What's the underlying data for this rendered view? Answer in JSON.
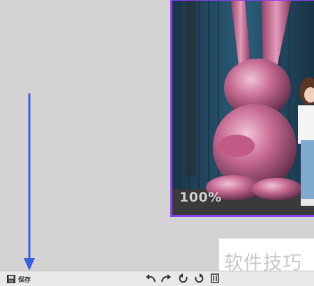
{
  "photo": {
    "zoom_label": "100%",
    "frame_color": "#8a3ff0"
  },
  "annotation": {
    "arrow_color": "#3a5ee0",
    "points_to": "save-button"
  },
  "toolbar": {
    "save_label": "保存",
    "icons": [
      "save-icon",
      "undo-icon",
      "redo-icon",
      "rotate-left-icon",
      "rotate-right-icon",
      "crop-icon"
    ]
  },
  "watermark": {
    "text": "软件技巧"
  }
}
